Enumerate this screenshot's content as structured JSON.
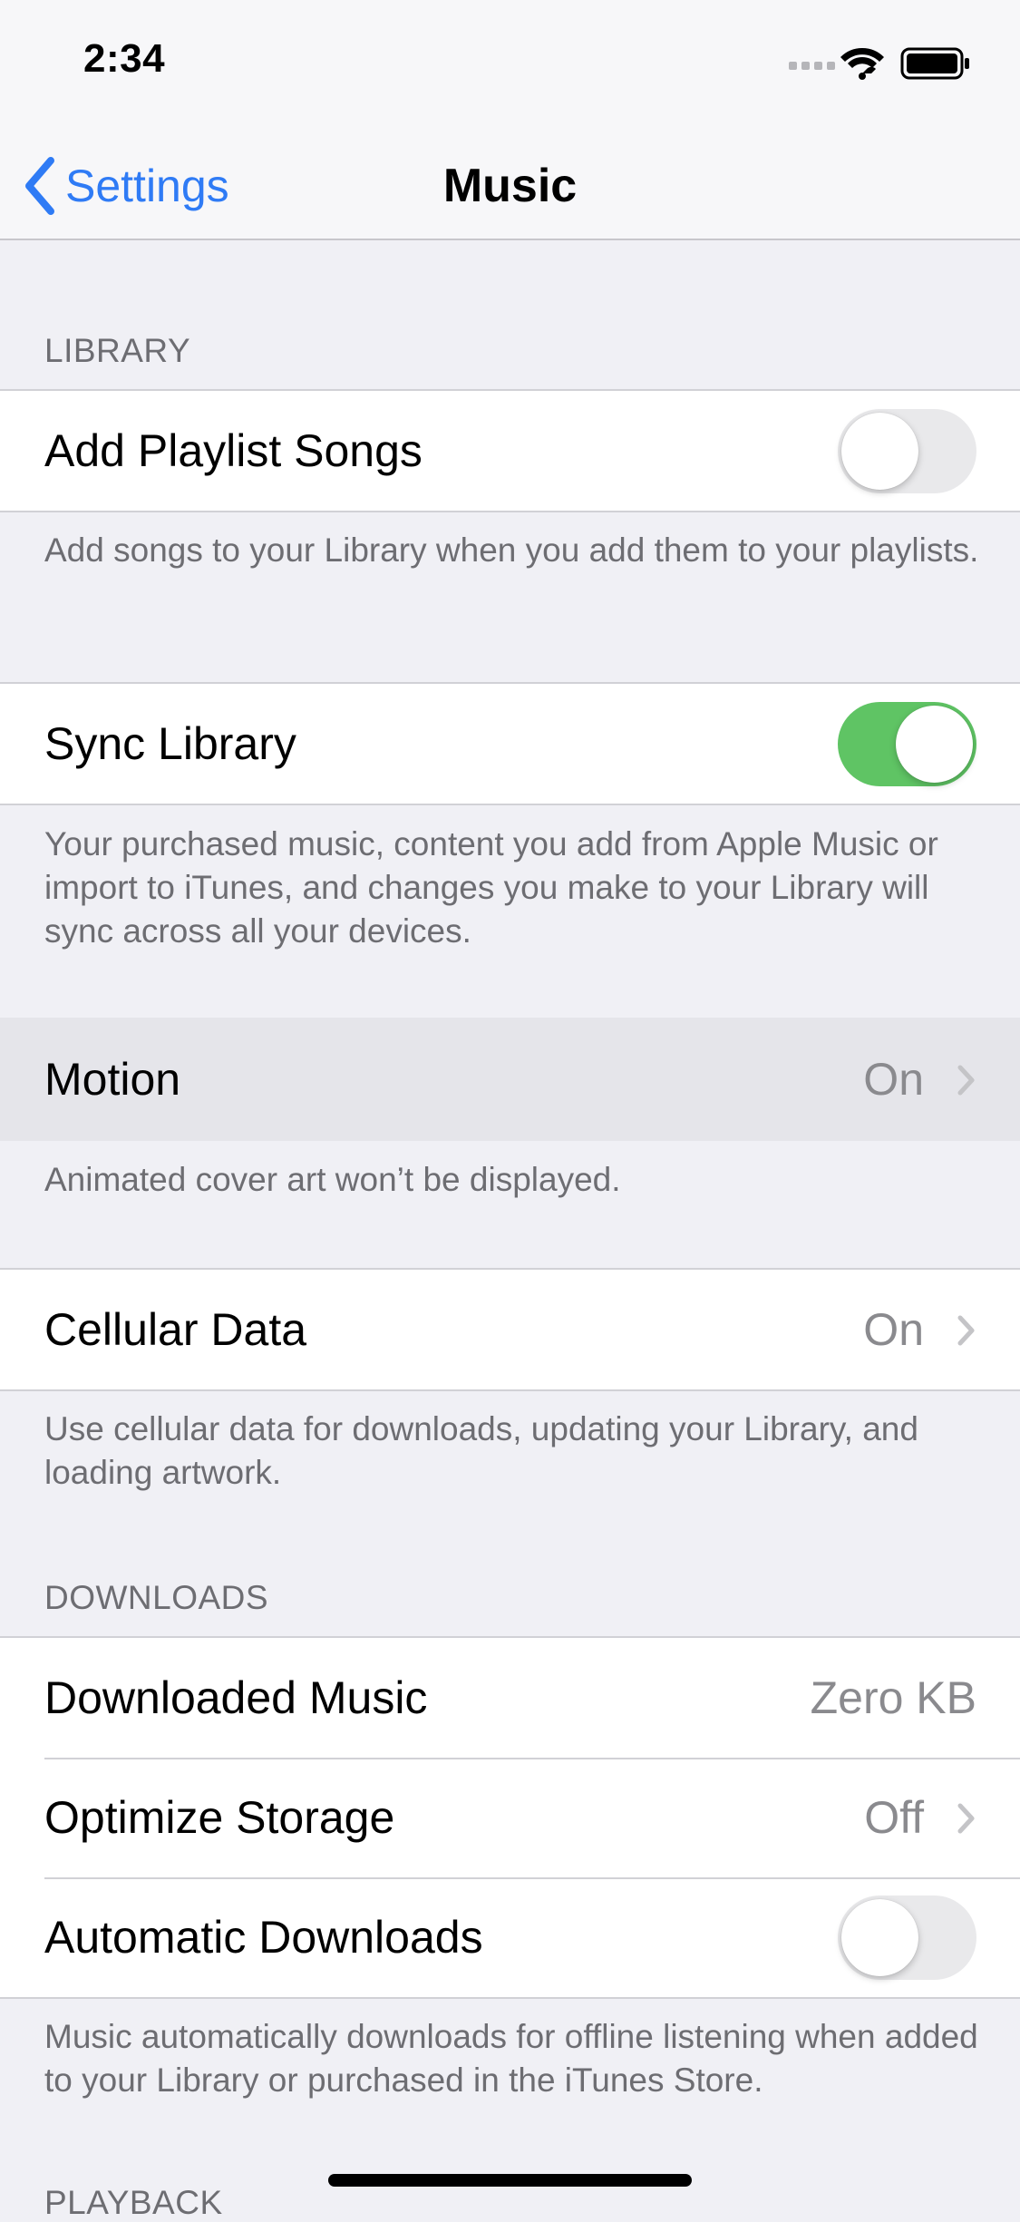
{
  "status_bar": {
    "time": "2:34"
  },
  "nav": {
    "back_label": "Settings",
    "title": "Music"
  },
  "library": {
    "header": "LIBRARY",
    "add_playlist_songs": {
      "label": "Add Playlist Songs",
      "on": false
    },
    "add_playlist_footer": "Add songs to your Library when you add them to your playlists.",
    "sync_library": {
      "label": "Sync Library",
      "on": true
    },
    "sync_footer": "Your purchased music, content you add from Apple Music or import to iTunes, and changes you make to your Library will sync across all your devices.",
    "motion": {
      "label": "Motion",
      "value": "On"
    },
    "motion_footer": "Animated cover art won’t be displayed.",
    "cellular": {
      "label": "Cellular Data",
      "value": "On"
    },
    "cellular_footer": "Use cellular data for downloads, updating your Library, and loading artwork."
  },
  "downloads": {
    "header": "DOWNLOADS",
    "downloaded_music": {
      "label": "Downloaded Music",
      "value": "Zero KB"
    },
    "optimize_storage": {
      "label": "Optimize Storage",
      "value": "Off"
    },
    "automatic_downloads": {
      "label": "Automatic Downloads",
      "on": false
    },
    "footer": "Music automatically downloads for offline listening when added to your Library or purchased in the iTunes Store."
  },
  "playback": {
    "header": "PLAYBACK"
  },
  "colors": {
    "accent": "#2F7BF5",
    "toggle_on": "#5FC464"
  }
}
